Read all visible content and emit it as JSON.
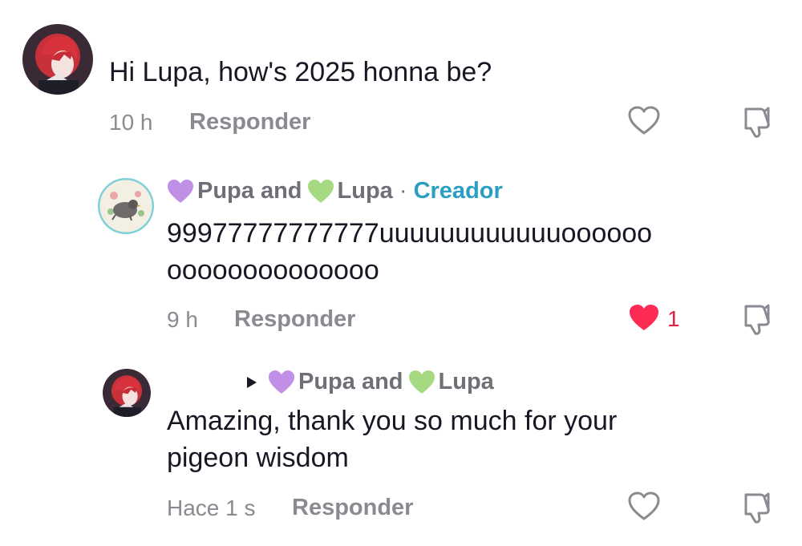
{
  "colors": {
    "text": "#161823",
    "meta": "#8a8b91",
    "creator": "#2a9fc2",
    "liked": "#fe2c55",
    "purple_heart": "#c08fe6",
    "green_heart": "#a6da82"
  },
  "comments": [
    {
      "text": "Hi Lupa, how's 2025 honna be?",
      "time": "10 h",
      "reply_label": "Responder",
      "like_icon": "heart-outline-icon",
      "dislike_icon": "thumbs-down-icon"
    },
    {
      "author_prefix": "Pupa and ",
      "author_suffix": "Lupa",
      "separator": " · ",
      "badge": "Creador",
      "text_line1": "99977777777777uuuuuuuuuuuuoooooo",
      "text_line2": "oooooooooooooo",
      "time": "9 h",
      "reply_label": "Responder",
      "like_icon": "heart-filled-icon",
      "like_count": "1",
      "dislike_icon": "thumbs-down-icon"
    },
    {
      "reply_to_prefix": "Pupa and ",
      "reply_to_suffix": "Lupa",
      "text_line1": "Amazing, thank you so much for your",
      "text_line2": "pigeon wisdom",
      "time": "Hace 1 s",
      "reply_label": "Responder",
      "like_icon": "heart-outline-icon",
      "dislike_icon": "thumbs-down-icon"
    }
  ]
}
